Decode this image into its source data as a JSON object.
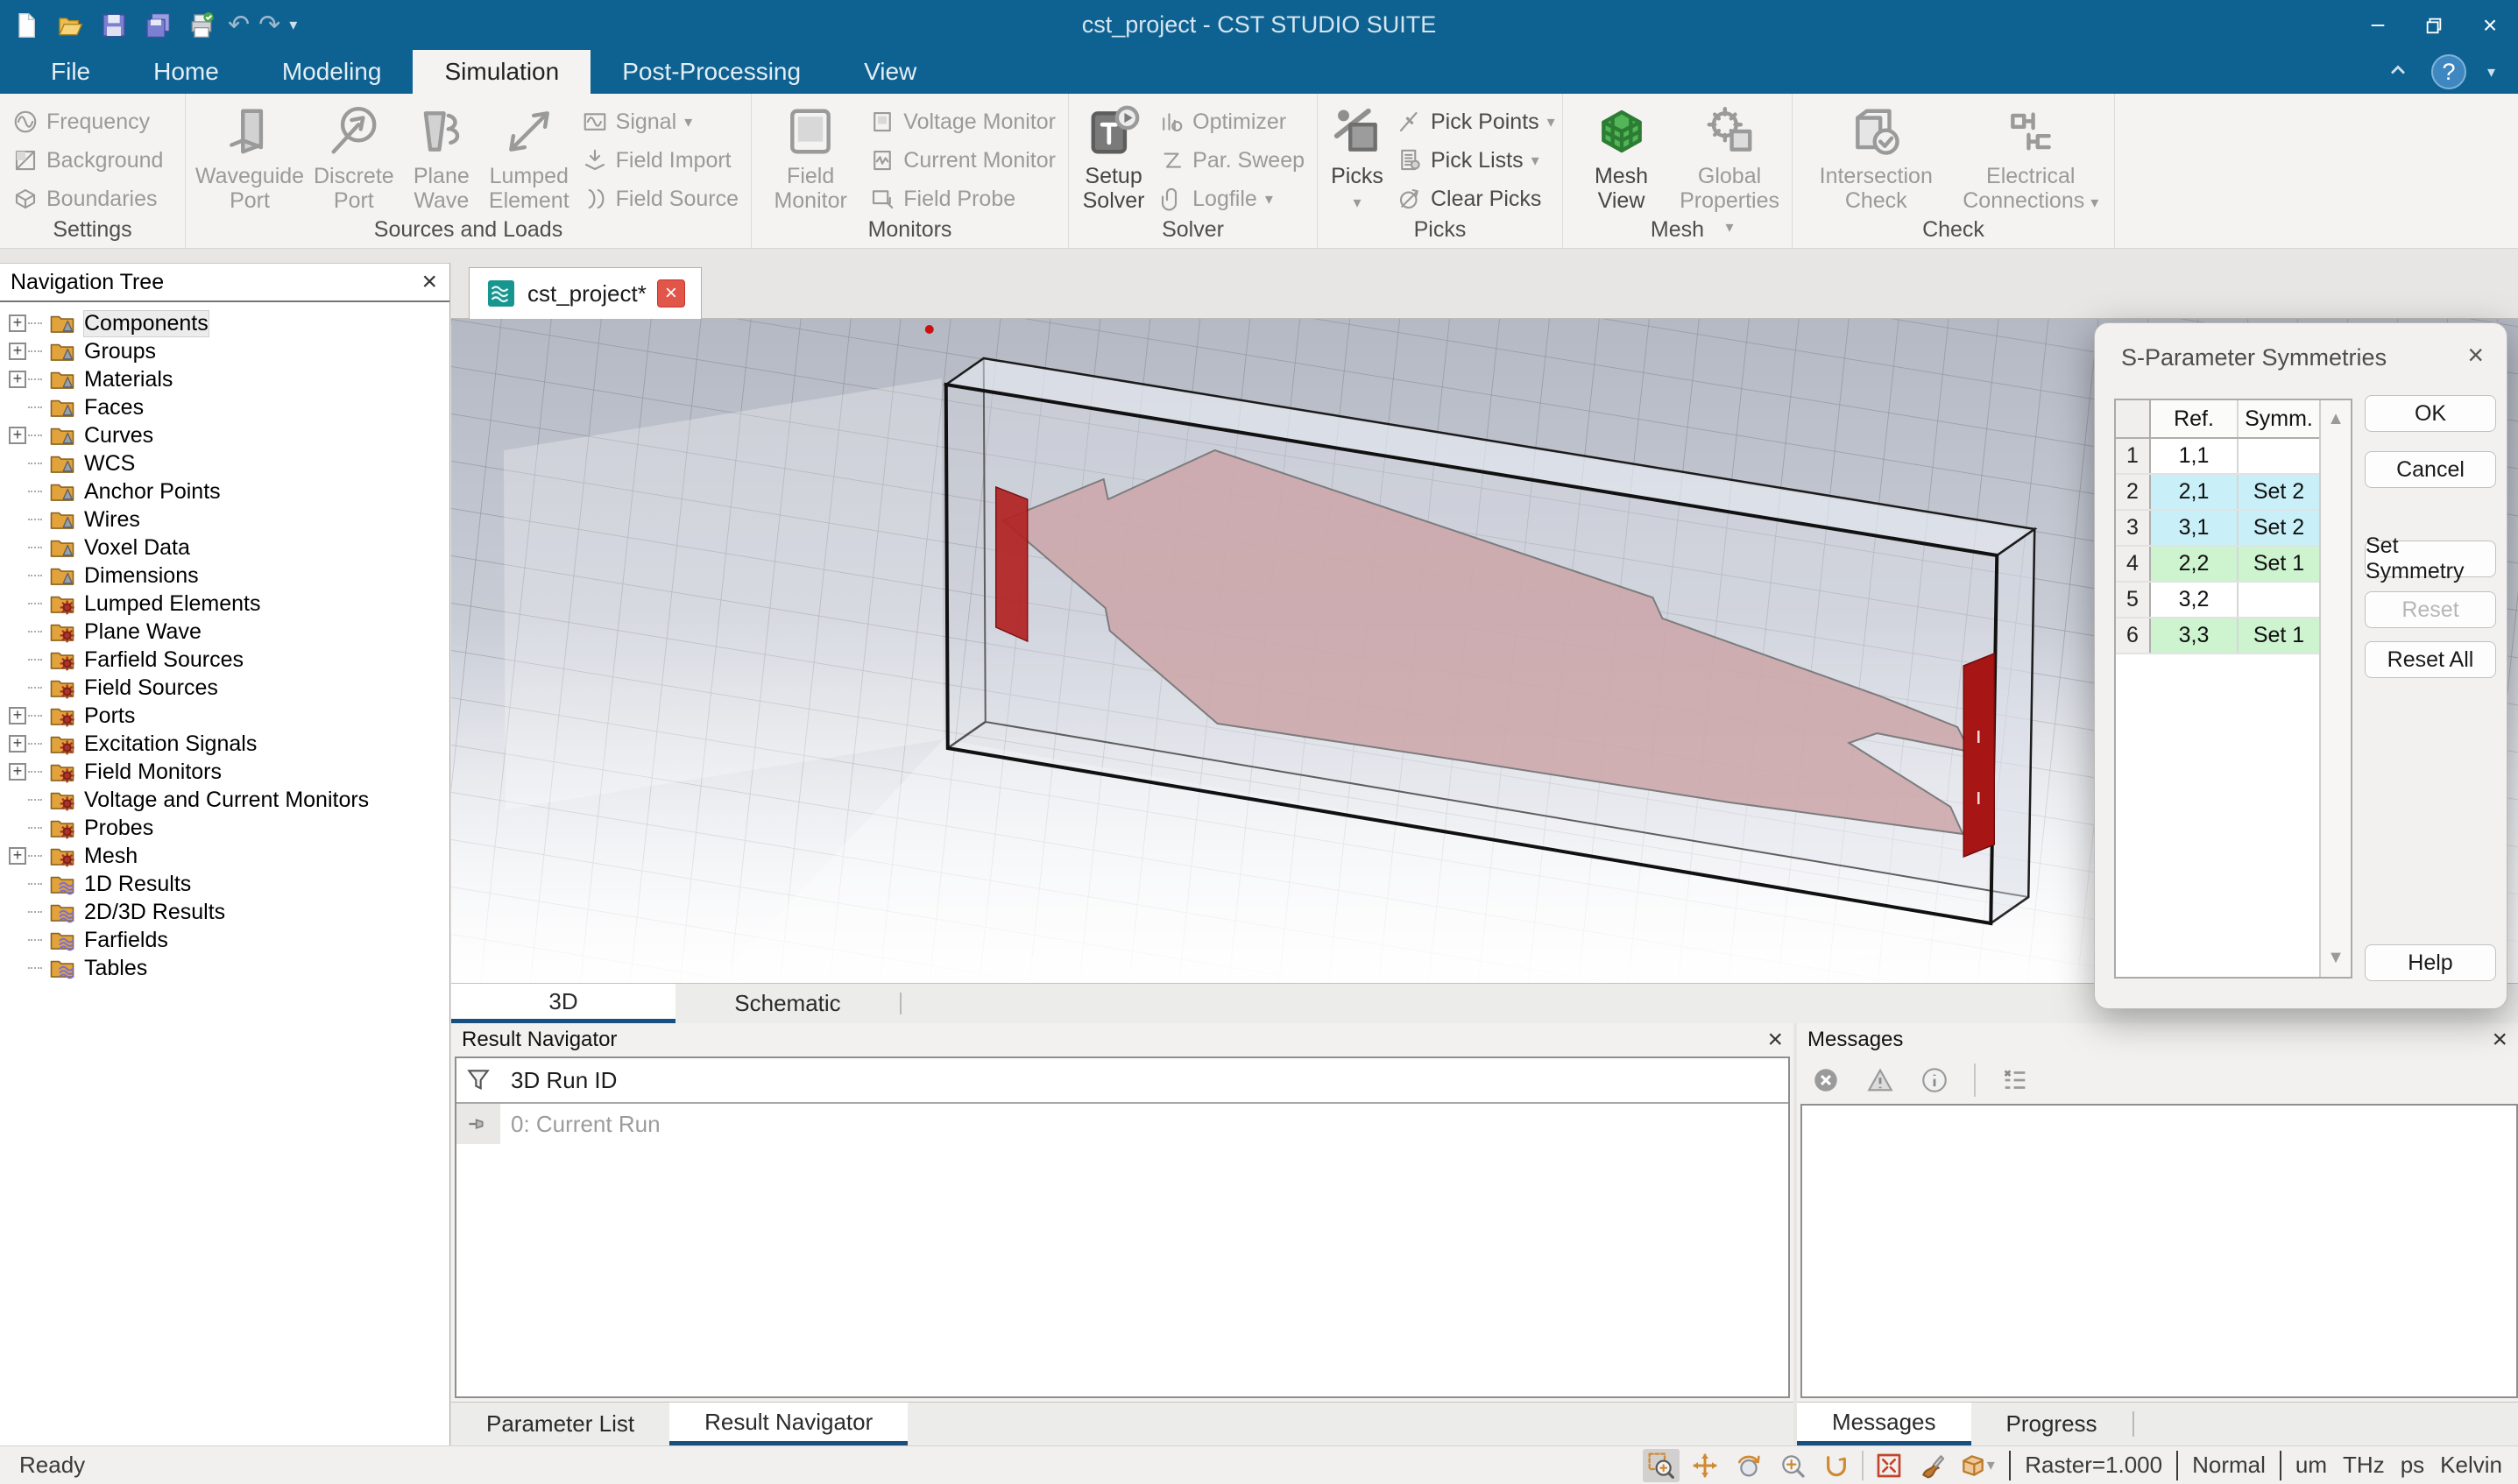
{
  "titlebar": {
    "title": "cst_project - CST STUDIO SUITE"
  },
  "menu": {
    "tabs": [
      "File",
      "Home",
      "Modeling",
      "Simulation",
      "Post-Processing",
      "View"
    ],
    "active": "Simulation"
  },
  "ribbon": {
    "groups": [
      {
        "label": "Settings",
        "small": [
          {
            "label": "Frequency",
            "icon": "frequency"
          },
          {
            "label": "Background",
            "icon": "background"
          },
          {
            "label": "Boundaries",
            "icon": "boundaries"
          }
        ]
      },
      {
        "label": "Sources and Loads",
        "large": [
          {
            "label": "Waveguide Port",
            "icon": "waveguide-port"
          },
          {
            "label": "Discrete Port",
            "icon": "discrete-port"
          },
          {
            "label": "Plane Wave",
            "icon": "plane-wave"
          },
          {
            "label": "Lumped Element",
            "icon": "lumped-element"
          }
        ],
        "small": [
          {
            "label": "Signal",
            "icon": "signal",
            "dd": true
          },
          {
            "label": "Field Import",
            "icon": "field-import"
          },
          {
            "label": "Field Source",
            "icon": "field-source"
          }
        ]
      },
      {
        "label": "Monitors",
        "large": [
          {
            "label": "Field Monitor",
            "icon": "field-monitor"
          }
        ],
        "small": [
          {
            "label": "Voltage Monitor",
            "icon": "voltage-monitor"
          },
          {
            "label": "Current Monitor",
            "icon": "current-monitor"
          },
          {
            "label": "Field Probe",
            "icon": "field-probe"
          }
        ]
      },
      {
        "label": "Solver",
        "large": [
          {
            "label": "Setup Solver",
            "icon": "setup-solver",
            "on": true
          }
        ],
        "small": [
          {
            "label": "Optimizer",
            "icon": "optimizer"
          },
          {
            "label": "Par. Sweep",
            "icon": "par-sweep"
          },
          {
            "label": "Logfile",
            "icon": "logfile",
            "dd": true
          }
        ]
      },
      {
        "label": "Picks",
        "large": [
          {
            "label": "Picks",
            "icon": "picks",
            "on": true,
            "dd": true
          }
        ],
        "small": [
          {
            "label": "Pick Points",
            "icon": "pick-points",
            "dd": true,
            "on": true
          },
          {
            "label": "Pick Lists",
            "icon": "pick-lists",
            "dd": true,
            "on": true
          },
          {
            "label": "Clear Picks",
            "icon": "clear-picks",
            "on": true
          }
        ]
      },
      {
        "label": "Mesh",
        "large": [
          {
            "label": "Mesh View",
            "icon": "mesh-view",
            "on": true
          },
          {
            "label": "Global Properties",
            "icon": "global-properties",
            "dd": true
          }
        ]
      },
      {
        "label": "Check",
        "large": [
          {
            "label": "Intersection Check",
            "icon": "intersection-check",
            "wide": true
          },
          {
            "label": "Electrical Connections",
            "icon": "electrical-connections",
            "dd": true,
            "wide": true
          }
        ]
      }
    ]
  },
  "tree": {
    "title": "Navigation Tree",
    "items": [
      {
        "label": "Components",
        "icon": "cone",
        "expand": true,
        "selected": true
      },
      {
        "label": "Groups",
        "icon": "cone",
        "expand": true
      },
      {
        "label": "Materials",
        "icon": "cone",
        "expand": true
      },
      {
        "label": "Faces",
        "icon": "cone"
      },
      {
        "label": "Curves",
        "icon": "cone",
        "expand": true
      },
      {
        "label": "WCS",
        "icon": "cone"
      },
      {
        "label": "Anchor Points",
        "icon": "cone"
      },
      {
        "label": "Wires",
        "icon": "cone"
      },
      {
        "label": "Voxel Data",
        "icon": "cone"
      },
      {
        "label": "Dimensions",
        "icon": "cone"
      },
      {
        "label": "Lumped Elements",
        "icon": "gear"
      },
      {
        "label": "Plane Wave",
        "icon": "gear"
      },
      {
        "label": "Farfield Sources",
        "icon": "gear"
      },
      {
        "label": "Field Sources",
        "icon": "gear"
      },
      {
        "label": "Ports",
        "icon": "gear",
        "expand": true
      },
      {
        "label": "Excitation Signals",
        "icon": "gear",
        "expand": true
      },
      {
        "label": "Field Monitors",
        "icon": "gear",
        "expand": true
      },
      {
        "label": "Voltage and Current Monitors",
        "icon": "gear"
      },
      {
        "label": "Probes",
        "icon": "gear"
      },
      {
        "label": "Mesh",
        "icon": "gear",
        "expand": true
      },
      {
        "label": "1D Results",
        "icon": "wave"
      },
      {
        "label": "2D/3D Results",
        "icon": "wave"
      },
      {
        "label": "Farfields",
        "icon": "wave"
      },
      {
        "label": "Tables",
        "icon": "wave"
      }
    ]
  },
  "doc_tab": {
    "label": "cst_project*"
  },
  "view_tabs": {
    "t3d": "3D",
    "schematic": "Schematic"
  },
  "dialog": {
    "title": "S-Parameter Symmetries",
    "columns": [
      "Ref.",
      "Symm."
    ],
    "rows": [
      {
        "n": "1",
        "ref": "1,1",
        "symm": "",
        "hl": ""
      },
      {
        "n": "2",
        "ref": "2,1",
        "symm": "Set 2",
        "hl": "cyan"
      },
      {
        "n": "3",
        "ref": "3,1",
        "symm": "Set 2",
        "hl": "cyan"
      },
      {
        "n": "4",
        "ref": "2,2",
        "symm": "Set 1",
        "hl": "green"
      },
      {
        "n": "5",
        "ref": "3,2",
        "symm": "",
        "hl": ""
      },
      {
        "n": "6",
        "ref": "3,3",
        "symm": "Set 1",
        "hl": "green"
      }
    ],
    "buttons": {
      "ok": "OK",
      "cancel": "Cancel",
      "set_symmetry": "Set Symmetry",
      "reset": "Reset",
      "reset_all": "Reset All",
      "help": "Help"
    },
    "highlight_colors": {
      "cyan": "#c9f0f8",
      "green": "#cdf3cf"
    }
  },
  "result_navigator": {
    "title": "Result Navigator",
    "filter_header": "3D Run ID",
    "run_item": "0: Current Run"
  },
  "messages": {
    "title": "Messages"
  },
  "bottom_tabs_left": {
    "parameter_list": "Parameter List",
    "result_navigator": "Result Navigator"
  },
  "bottom_tabs_right": {
    "messages": "Messages",
    "progress": "Progress"
  },
  "status": {
    "ready": "Ready",
    "raster": "Raster=1.000",
    "mode": "Normal",
    "units": [
      "um",
      "THz",
      "ps",
      "Kelvin"
    ],
    "tools": [
      {
        "icon": "zoom-select",
        "active": true
      },
      {
        "icon": "pan"
      },
      {
        "icon": "rotate"
      },
      {
        "icon": "zoom-pm"
      },
      {
        "icon": "spin"
      },
      {
        "icon": "sep"
      },
      {
        "icon": "fit"
      },
      {
        "icon": "paint"
      },
      {
        "icon": "bbox",
        "dd": true
      }
    ]
  },
  "colors": {
    "titlebar": "#0e6292",
    "accent": "#17507e",
    "port_red": "#b22222",
    "plate_pink": "#c49597",
    "mesh_green": "#52b557"
  }
}
